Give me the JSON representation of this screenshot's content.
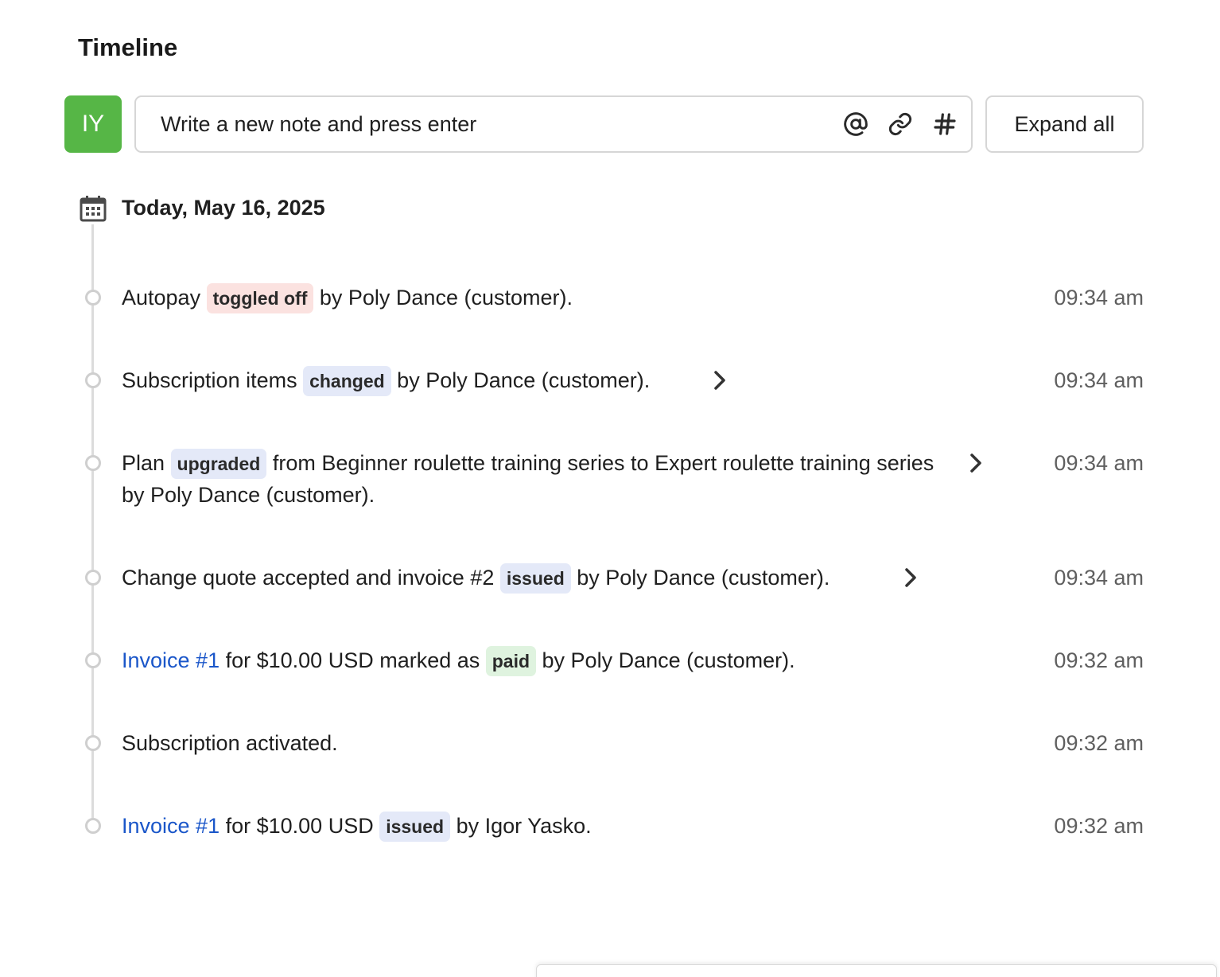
{
  "header": {
    "title": "Timeline"
  },
  "composer": {
    "avatar_initials": "IY",
    "avatar_color": "#56b646",
    "placeholder": "Write a new note and press enter",
    "tools": [
      "mention-icon",
      "attachment-icon",
      "hashtag-icon"
    ],
    "expand_label": "Expand all"
  },
  "day": {
    "label": "Today, May 16, 2025"
  },
  "events": [
    {
      "pre": "Autopay ",
      "tag": "toggled off",
      "post": " by Poly Dance (customer).",
      "time": "09:34 am"
    },
    {
      "pre": "Subscription items ",
      "tag": "changed",
      "post": " by Poly Dance (customer).",
      "time": "09:34 am"
    },
    {
      "pre": "Plan ",
      "tag": "upgraded",
      "post": " from Beginner roulette training series to Expert roulette training series by Poly Dance (customer).",
      "time": "09:34 am"
    },
    {
      "pre": "Change quote accepted and invoice #2 ",
      "tag": "issued",
      "post": " by Poly Dance (customer).",
      "time": "09:34 am"
    },
    {
      "link": "Invoice #1",
      "pre": " for $10.00 USD marked as ",
      "tag": "paid",
      "post": " by Poly Dance (customer).",
      "time": "09:32 am"
    },
    {
      "pre": "Subscription activated.",
      "time": "09:32 am"
    },
    {
      "link": "Invoice #1",
      "pre": " for $10.00 USD ",
      "tag": "issued",
      "post": " by Igor Yasko.",
      "time": "09:32 am"
    }
  ],
  "colors": {
    "link": "#1a56c9",
    "tag_red": "#fbe2e0",
    "tag_blue": "#e4e9f8",
    "tag_green": "#dff3df"
  }
}
